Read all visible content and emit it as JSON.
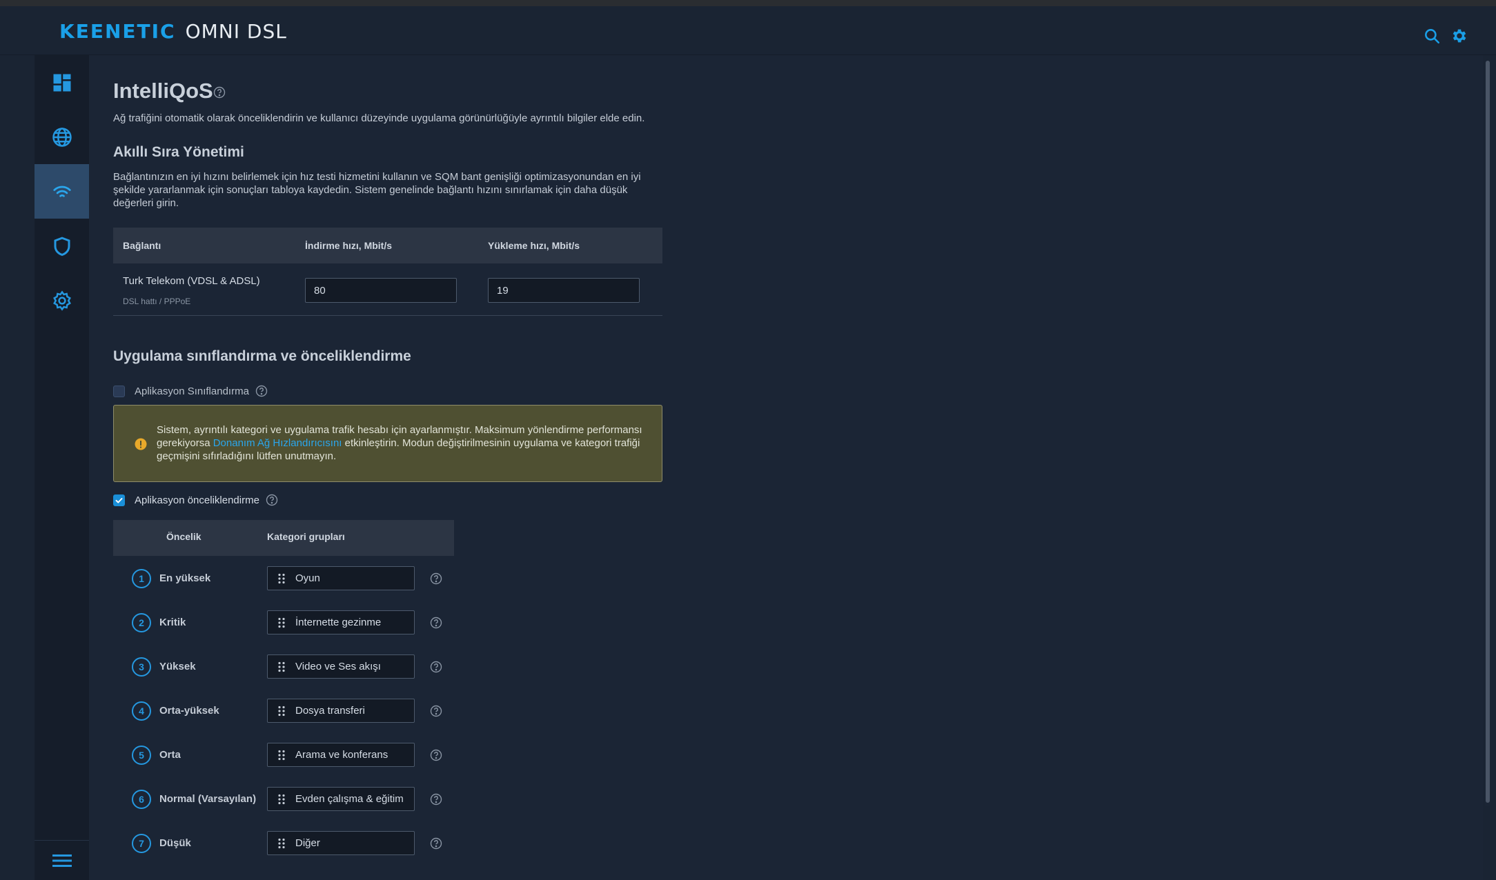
{
  "header": {
    "brand": "KEENETIC",
    "model": "OMNI DSL",
    "icons": [
      "search-icon",
      "gear-icon"
    ],
    "accent_color": "#1aa0e8"
  },
  "sidebar": {
    "items": [
      {
        "icon": "dashboard-icon",
        "active": false
      },
      {
        "icon": "globe-icon",
        "active": false
      },
      {
        "icon": "wifi-icon",
        "active": true
      },
      {
        "icon": "shield-icon",
        "active": false
      },
      {
        "icon": "settings-icon",
        "active": false
      }
    ],
    "bottom_icon": "menu-icon"
  },
  "page": {
    "title": "IntelliQoS",
    "subtitle": "Ağ trafiğini otomatik olarak önceliklendirin ve kullanıcı düzeyinde uygulama görünürlüğüyle ayrıntılı bilgiler elde edin."
  },
  "sqm": {
    "heading": "Akıllı Sıra Yönetimi",
    "description": "Bağlantınızın en iyi hızını belirlemek için hız testi hizmetini kullanın ve SQM bant genişliği optimizasyonundan en iyi şekilde yararlanmak için sonuçları tabloya kaydedin. Sistem genelinde bağlantı hızını sınırlamak için daha düşük değerleri girin.",
    "columns": [
      "Bağlantı",
      "İndirme hızı, Mbit/s",
      "Yükleme hızı, Mbit/s"
    ],
    "rows": [
      {
        "name": "Turk Telekom (VDSL & ADSL)",
        "sub": "DSL hattı / PPPoE",
        "download": "80",
        "upload": "19"
      }
    ]
  },
  "classification": {
    "heading": "Uygulama sınıflandırma ve önceliklendirme",
    "app_classification_label": "Aplikasyon Sınıflandırma",
    "app_classification_checked": false,
    "warning_before": "Sistem, ayrıntılı kategori ve uygulama trafik hesabı için ayarlanmıştır. Maksimum yönlendirme performansı gerekiyorsa ",
    "warning_link": "Donanım Ağ Hızlandırıcısını",
    "warning_after": " etkinleştirin. Modun değiştirilmesinin uygulama ve kategori trafiği geçmişini sıfırladığını lütfen unutmayın.",
    "app_priority_label": "Aplikasyon önceliklendirme",
    "app_priority_checked": true
  },
  "priorities": {
    "columns": [
      "Öncelik",
      "Kategori grupları"
    ],
    "rows": [
      {
        "num": "1",
        "label": "En yüksek",
        "category": "Oyun"
      },
      {
        "num": "2",
        "label": "Kritik",
        "category": "İnternette gezinme"
      },
      {
        "num": "3",
        "label": "Yüksek",
        "category": "Video ve Ses akışı"
      },
      {
        "num": "4",
        "label": "Orta-yüksek",
        "category": "Dosya transferi"
      },
      {
        "num": "5",
        "label": "Orta",
        "category": "Arama ve konferans"
      },
      {
        "num": "6",
        "label": "Normal (Varsayılan)",
        "category": "Evden çalışma & eğitim"
      },
      {
        "num": "7",
        "label": "Düşük",
        "category": "Diğer"
      }
    ]
  }
}
